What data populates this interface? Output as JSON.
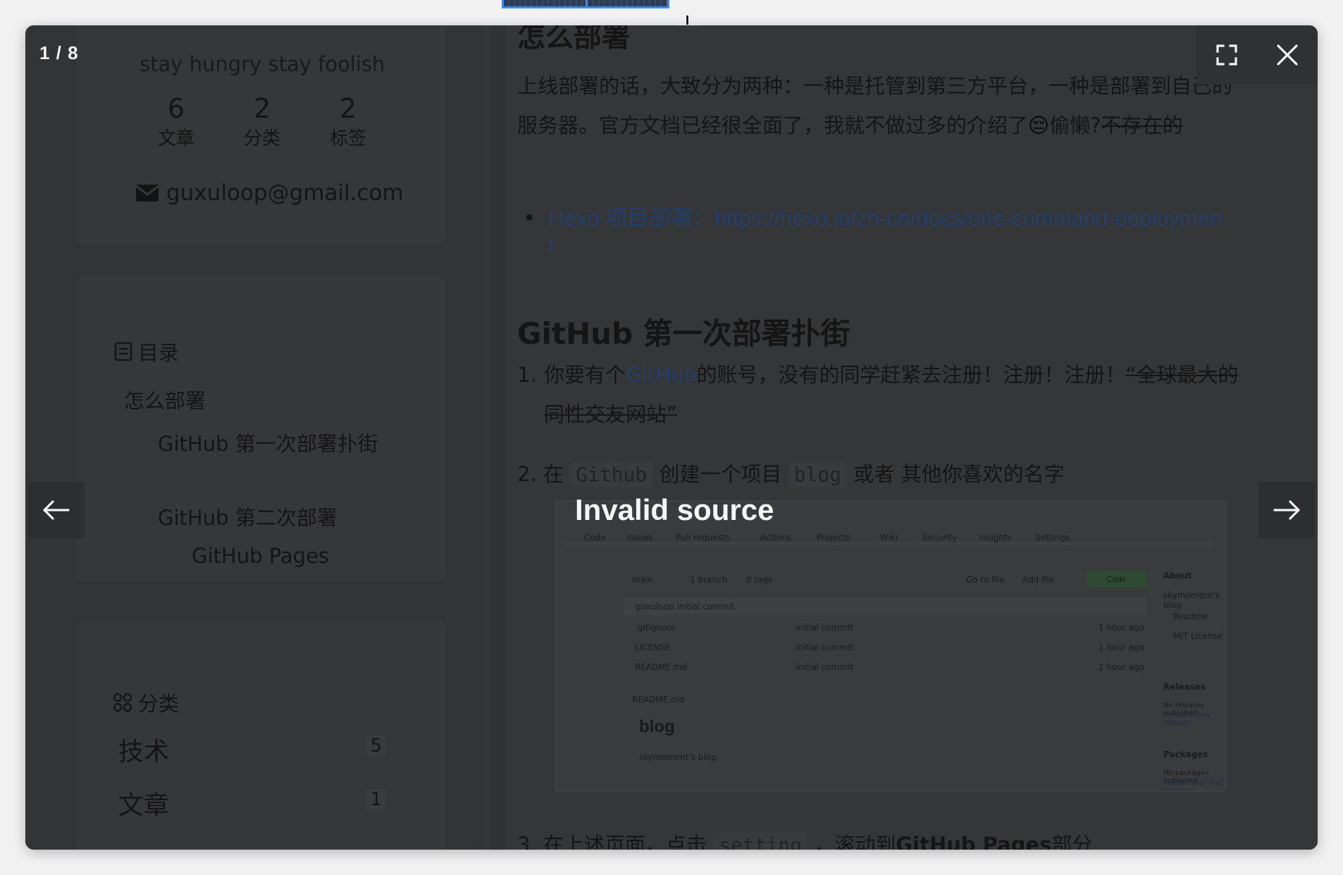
{
  "viewer": {
    "counter": "1 / 8",
    "error_text": "Invalid source"
  },
  "profile": {
    "motto": "stay hungry stay foolish",
    "stats": [
      {
        "count": "6",
        "label": "文章"
      },
      {
        "count": "2",
        "label": "分类"
      },
      {
        "count": "2",
        "label": "标签"
      }
    ],
    "email": "guxuloop@gmail.com"
  },
  "toc": {
    "title": "目录",
    "items": [
      "怎么部署",
      "GitHub 第一次部署扑街",
      "GitHub 第二次部署",
      "GitHub Pages"
    ]
  },
  "categories": {
    "title": "分类",
    "items": [
      {
        "name": "技术",
        "count": "5"
      },
      {
        "name": "文章",
        "count": "1"
      }
    ]
  },
  "article": {
    "heading_top": "怎么部署",
    "para1": "上线部署的话，大致分为两种：一种是托管到第三方平台，一种是部署到自己的服务器。官方文档已经很全面了，我就不做过多的介绍了",
    "para1_emoji": "😔",
    "para1_after_emoji": "偷懒?",
    "para1_strike": "不存在的",
    "bullet_label": "Hexo 项目部署：",
    "bullet_link": "https://hexo.io/zh-cn/docs/one-command-deployment",
    "heading2": "GitHub 第一次部署扑街",
    "step1_prefix": "你要有个",
    "step1_link": "GitHub",
    "step1_suffix": "的账号，没有的同学赶紧去注册！注册！注册！",
    "step1_strike": "“全球最大的同性交友网站”",
    "step2_prefix": "在",
    "step2_code1": "Github",
    "step2_middle": "创建一个项目",
    "step2_code2": "blog",
    "step2_suffix": "或者 其他你喜欢的名字",
    "step3_prefix": "在上述页面，点击",
    "step3_code": "setting",
    "step3_middle": "，滚动到",
    "step3_bold": "GitHub Pages",
    "step3_suffix": "部分"
  },
  "embedded_screenshot": {
    "tabs": [
      "Code",
      "Issues",
      "Pull requests",
      "Actions",
      "Projects",
      "Wiki",
      "Security",
      "Insights",
      "Settings"
    ],
    "branch": "main",
    "branches": "1 branch",
    "tags": "0 tags",
    "go_to_file": "Go to file",
    "add_file": "Add file",
    "code_button": "Code",
    "commit_author": "guxuloop initial commit",
    "files": [
      ".gitignore",
      "LICENSE",
      "README.md"
    ],
    "file_commit": "initial commit",
    "file_age": "1 hour ago",
    "readme_label": "README.md",
    "readme_title": "blog",
    "readme_sub": "skymoment's blog",
    "about_title": "About",
    "about_desc": "skymoment's blog",
    "about_readme": "Readme",
    "about_license": "MIT License",
    "releases_title": "Releases",
    "releases_desc": "No releases published",
    "releases_link": "Create a new release",
    "packages_title": "Packages",
    "packages_desc": "No packages published",
    "packages_link": "Publish your first package"
  }
}
